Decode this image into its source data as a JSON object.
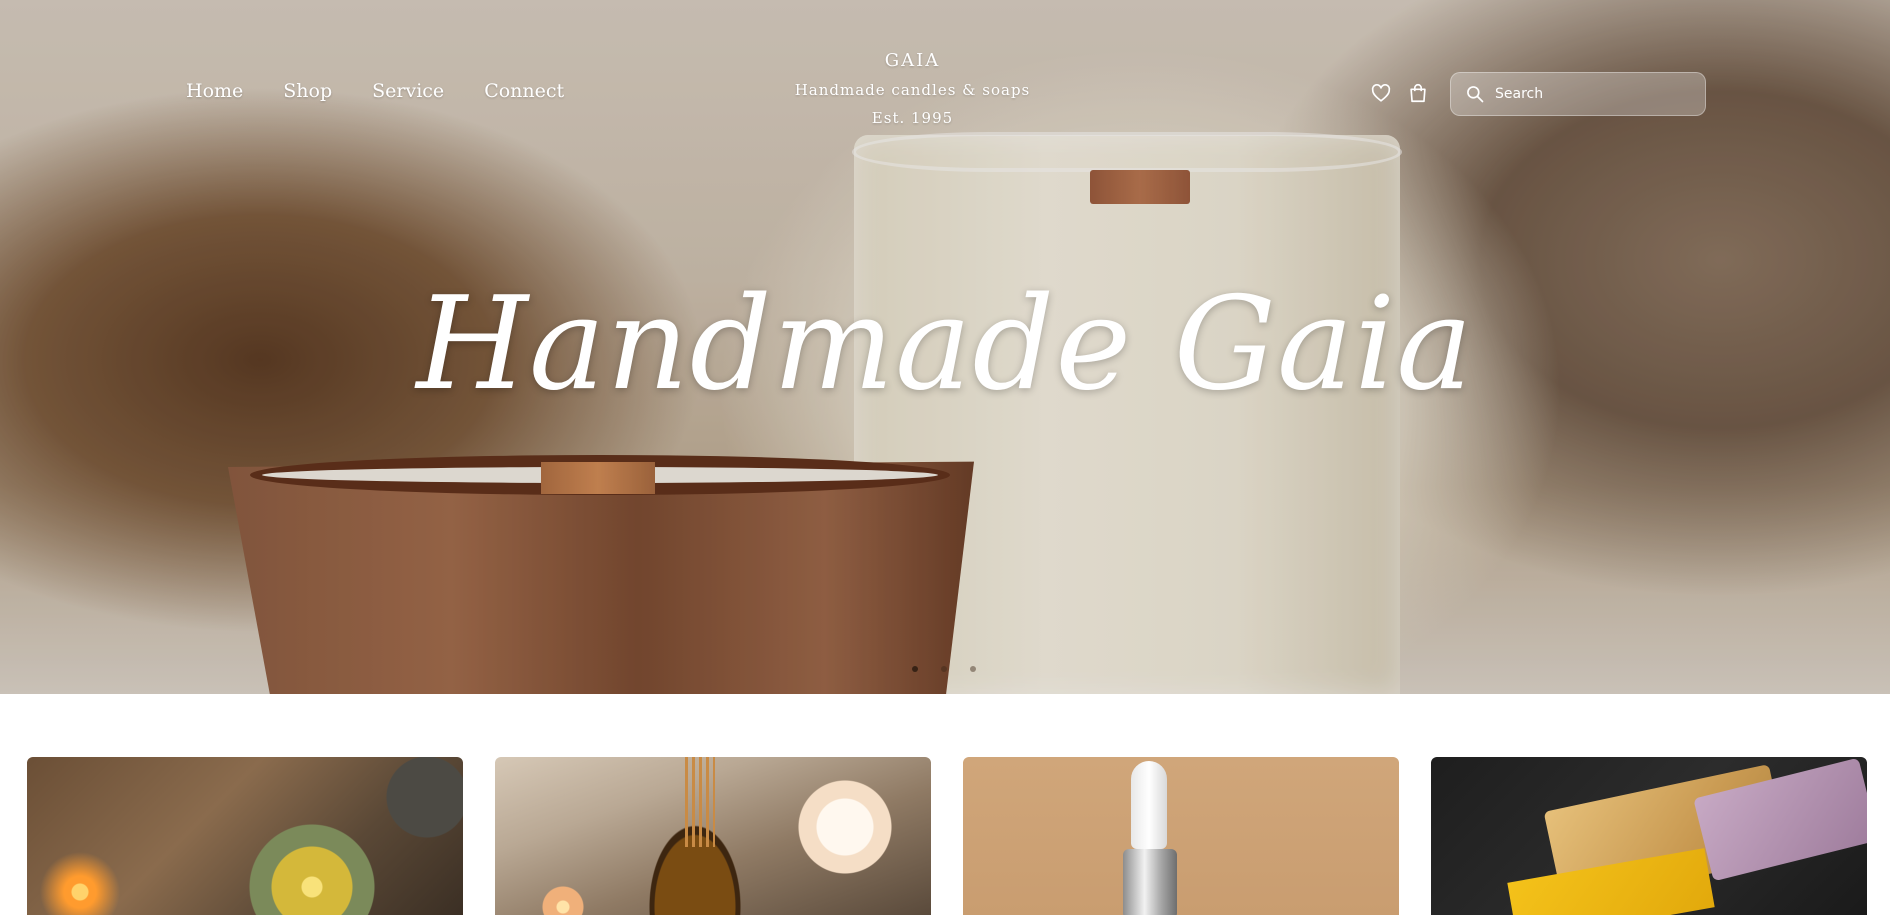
{
  "nav": {
    "items": [
      {
        "label": "Home"
      },
      {
        "label": "Shop"
      },
      {
        "label": "Service"
      },
      {
        "label": "Connect"
      }
    ]
  },
  "brand": {
    "name": "GAIA",
    "tagline": "Handmade candles & soaps",
    "established": "Est. 1995"
  },
  "header_icons": [
    {
      "icon": "heart-icon",
      "label": "Wishlist"
    },
    {
      "icon": "shopping-bag-icon",
      "label": "Cart"
    }
  ],
  "search": {
    "placeholder": "Search",
    "value": ""
  },
  "hero": {
    "title": "Handmade Gaia",
    "carousel": {
      "slides": 3,
      "active": 1
    }
  },
  "products": [
    {
      "image": "candles-on-wooden-table"
    },
    {
      "image": "reed-diffuser-and-bubble-candle"
    },
    {
      "image": "serum-dropper-bottle"
    },
    {
      "image": "handmade-soap-bars"
    }
  ],
  "colors": {
    "hero_text": "#ffffff",
    "page_background": "#ffffff"
  }
}
